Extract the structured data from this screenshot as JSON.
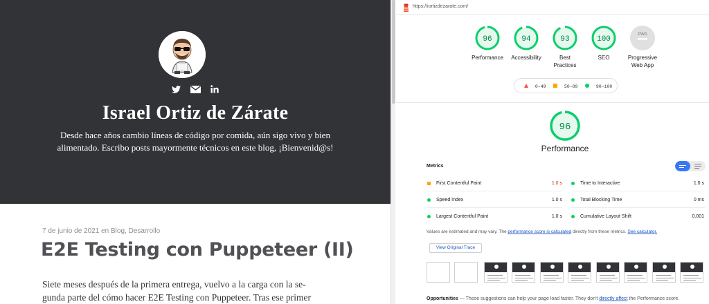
{
  "blog": {
    "title": "Israel Ortiz de Zárate",
    "description": "Desde hace años cambio líneas de código por comida, aún sigo vivo y bien alimentado. Escribo posts mayormente técnicos en este blog, ¡Bienvenid@s!",
    "social_icons": [
      "twitter-icon",
      "email-icon",
      "linkedin-icon"
    ],
    "post": {
      "date": "7 de junio de 2021",
      "in_word": "en",
      "categories": [
        "Blog",
        "Desarrollo"
      ],
      "title": "E2E Testing con Puppeteer (II)",
      "body_lines": [
        "Siete meses después de la primera entrega, vuelvo a la carga con la se-",
        "gunda parte del cómo hacer E2E Testing con Puppeteer. Tras ese primer"
      ]
    },
    "colors": {
      "hero_bg": "#323336",
      "post_title": "#515155"
    }
  },
  "lighthouse": {
    "url": "https://iortizdezarate.com/",
    "gauges": [
      {
        "score": "96",
        "label": "Performance"
      },
      {
        "score": "94",
        "label": "Accessibility"
      },
      {
        "score": "93",
        "label": "Best Practices"
      },
      {
        "score": "100",
        "label": "SEO"
      },
      {
        "score": "PWA",
        "label": "Progressive Web App"
      }
    ],
    "legend": [
      {
        "range": "0–49",
        "color": "#ff4e42",
        "shape": "triangle"
      },
      {
        "range": "50–89",
        "color": "#ffa400",
        "shape": "square"
      },
      {
        "range": "90–100",
        "color": "#0cce6b",
        "shape": "circle"
      }
    ],
    "main_score": "96",
    "main_title": "Performance",
    "metrics_title": "Metrics",
    "metrics": [
      {
        "label": "First Contentful Paint",
        "value": "1.0 s",
        "status": "average"
      },
      {
        "label": "Time to Interactive",
        "value": "1.0 s",
        "status": "pass"
      },
      {
        "label": "Speed Index",
        "value": "1.0 s",
        "status": "pass"
      },
      {
        "label": "Total Blocking Time",
        "value": "0 ms",
        "status": "pass"
      },
      {
        "label": "Largest Contentful Paint",
        "value": "1.0 s",
        "status": "pass"
      },
      {
        "label": "Cumulative Layout Shift",
        "value": "0.001",
        "status": "pass"
      }
    ],
    "note": {
      "pre": "Values are estimated and may vary. The ",
      "link1": "performance score is calculated",
      "mid": " directly from these metrics. ",
      "link2": "See calculator."
    },
    "trace_button": "View Original Trace",
    "opportunities": {
      "title": "Opportunities",
      "pre": " — These suggestions can help your page load faster. They don't ",
      "link": "directly affect",
      "post": " the Performance score."
    },
    "colors": {
      "pass": "#0cce6b",
      "pass_text": "#018642",
      "average": "#ffa400",
      "average_text": "#c33300",
      "fail": "#ff4e42",
      "link": "#1a56c4"
    }
  }
}
